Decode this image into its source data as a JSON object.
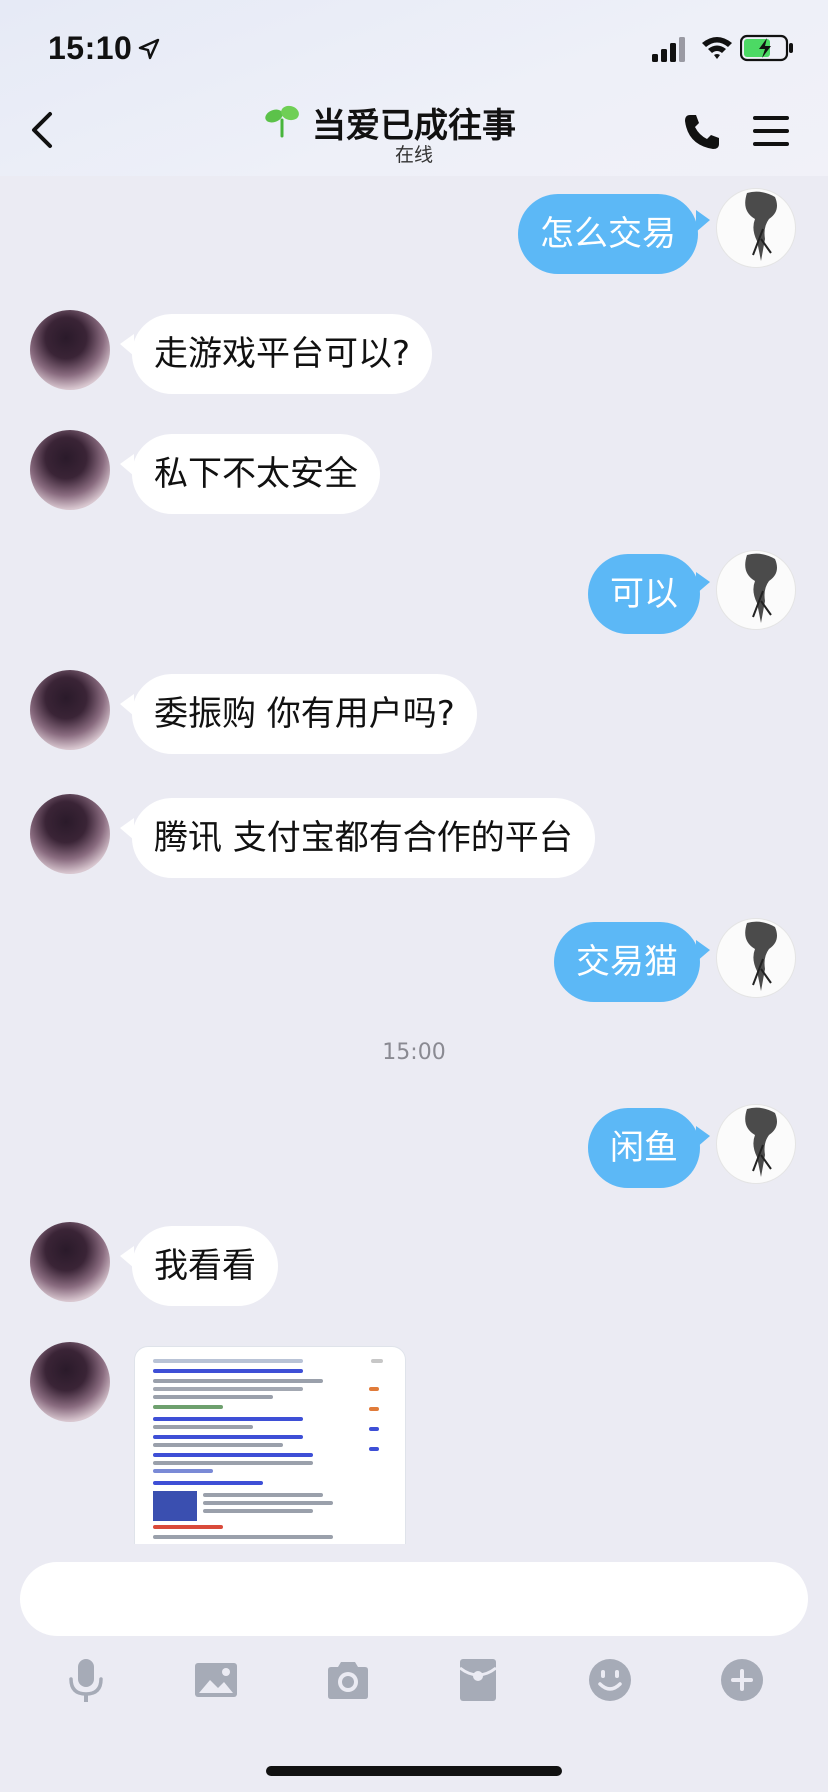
{
  "status_bar": {
    "time": "15:10"
  },
  "header": {
    "title": "当爱已成往事",
    "subtitle": "在线"
  },
  "messages": [
    {
      "from": "me",
      "text": "怎么交易"
    },
    {
      "from": "other",
      "text": "走游戏平台可以?"
    },
    {
      "from": "other",
      "text": "私下不太安全"
    },
    {
      "from": "me",
      "text": "可以"
    },
    {
      "from": "other",
      "text": "委振购 你有用户吗?"
    },
    {
      "from": "other",
      "text": "腾讯 支付宝都有合作的平台"
    },
    {
      "from": "me",
      "text": "交易猫"
    },
    {
      "from": "me",
      "text": "闲鱼"
    },
    {
      "from": "other",
      "text": "我看看"
    }
  ],
  "timestamp": "15:00",
  "input": {
    "placeholder": ""
  },
  "toolbar": [
    "microphone-icon",
    "image-icon",
    "camera-icon",
    "red-packet-icon",
    "emoji-icon",
    "plus-icon"
  ],
  "colors": {
    "my_bubble": "#5cb8f6",
    "other_bubble": "#ffffff",
    "background": "#ebebf3"
  }
}
